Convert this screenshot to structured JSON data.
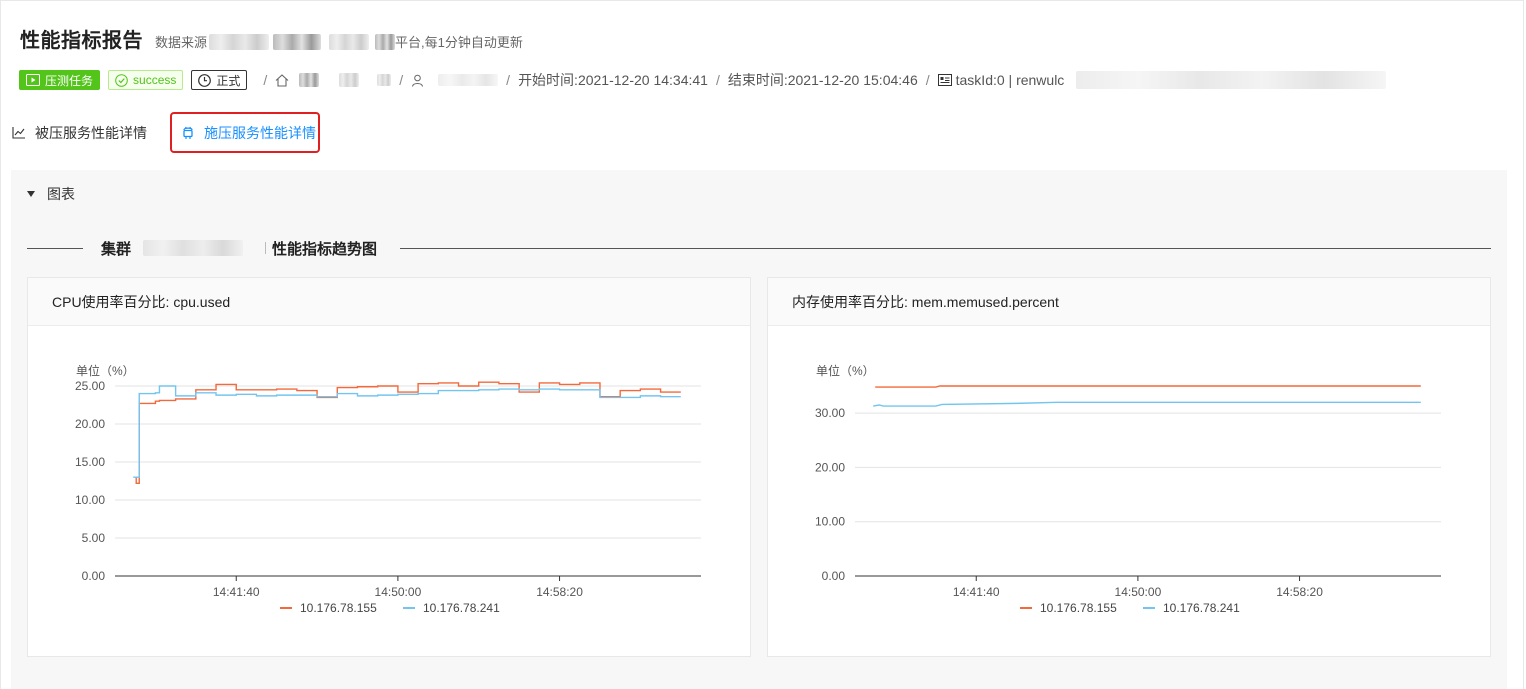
{
  "header": {
    "title": "性能指标报告",
    "subtitle_prefix": "数据来源",
    "subtitle_suffix": "平台,每1分钟自动更新"
  },
  "meta": {
    "tag_task": "压测任务",
    "tag_status": "success",
    "tag_mode": "正式",
    "start_time": "开始时间:2021-12-20 14:34:41",
    "end_time": "结束时间:2021-12-20 15:04:46",
    "task_id": "taskId:0 | renwulc"
  },
  "tabs": [
    {
      "label": "被压服务性能详情",
      "icon": "line-chart-icon",
      "active": false
    },
    {
      "label": "施压服务性能详情",
      "icon": "android-icon",
      "active": true
    }
  ],
  "section": {
    "collapse_label": "图表",
    "title_prefix": "集群",
    "title_suffix": "性能指标趋势图"
  },
  "colors": {
    "series1": "#f4693b",
    "series2": "#73c5ef",
    "link": "#1890ff"
  },
  "chart_data": [
    {
      "type": "line",
      "title": "CPU使用率百分比: cpu.used",
      "ylabel": "单位（%）",
      "ylim": [
        0,
        25
      ],
      "yticks": [
        "25.00",
        "20.00",
        "15.00",
        "10.00",
        "5.00",
        "0.00"
      ],
      "xticks": [
        "14:41:40",
        "14:50:00",
        "14:58:20"
      ],
      "xlim": [
        0,
        29
      ],
      "xtick_positions": [
        6,
        14,
        22
      ],
      "series": [
        {
          "name": "10.176.78.155",
          "step": true,
          "values": [
            [
              1,
              13
            ],
            [
              1.05,
              12.2
            ],
            [
              1.2,
              22.7
            ],
            [
              2,
              23.0
            ],
            [
              2.2,
              23.1
            ],
            [
              3,
              23.3
            ],
            [
              4,
              24.5
            ],
            [
              5,
              25.2
            ],
            [
              6,
              24.5
            ],
            [
              7,
              24.5
            ],
            [
              8,
              24.6
            ],
            [
              9,
              24.4
            ],
            [
              10,
              23.5
            ],
            [
              11,
              24.8
            ],
            [
              12,
              24.9
            ],
            [
              13,
              25.0
            ],
            [
              14,
              24.2
            ],
            [
              15,
              25.3
            ],
            [
              16,
              25.4
            ],
            [
              17,
              25.0
            ],
            [
              18,
              25.5
            ],
            [
              19,
              25.3
            ],
            [
              20,
              24.2
            ],
            [
              21,
              25.4
            ],
            [
              22,
              25.2
            ],
            [
              23,
              25.4
            ],
            [
              24,
              23.6
            ],
            [
              25,
              24.4
            ],
            [
              26,
              24.6
            ],
            [
              27,
              24.2
            ],
            [
              28,
              24.2
            ]
          ]
        },
        {
          "name": "10.176.78.241",
          "step": true,
          "values": [
            [
              0.9,
              13
            ],
            [
              1.1,
              13
            ],
            [
              1.2,
              24.0
            ],
            [
              2,
              24.1
            ],
            [
              2.2,
              25.0
            ],
            [
              3,
              23.7
            ],
            [
              4,
              24.1
            ],
            [
              5,
              23.8
            ],
            [
              6,
              23.9
            ],
            [
              7,
              23.7
            ],
            [
              8,
              23.8
            ],
            [
              9,
              23.8
            ],
            [
              10,
              23.6
            ],
            [
              11,
              24.0
            ],
            [
              12,
              23.7
            ],
            [
              13,
              23.8
            ],
            [
              14,
              23.9
            ],
            [
              15,
              24.0
            ],
            [
              16,
              24.4
            ],
            [
              17,
              24.4
            ],
            [
              18,
              24.5
            ],
            [
              19,
              24.6
            ],
            [
              20,
              24.5
            ],
            [
              21,
              24.6
            ],
            [
              22,
              24.5
            ],
            [
              23,
              24.5
            ],
            [
              24,
              23.5
            ],
            [
              25,
              23.5
            ],
            [
              26,
              23.7
            ],
            [
              27,
              23.6
            ],
            [
              28,
              23.6
            ]
          ]
        }
      ]
    },
    {
      "type": "line",
      "title": "内存使用率百分比: mem.memused.percent",
      "ylabel": "单位（%）",
      "ylim": [
        0,
        35
      ],
      "yticks": [
        "30.00",
        "20.00",
        "10.00",
        "0.00"
      ],
      "xticks": [
        "14:41:40",
        "14:50:00",
        "14:58:20"
      ],
      "xlim": [
        0,
        29
      ],
      "xtick_positions": [
        6,
        14,
        22
      ],
      "series": [
        {
          "name": "10.176.78.155",
          "step": false,
          "values": [
            [
              1,
              34.8
            ],
            [
              4,
              34.8
            ],
            [
              4.2,
              35.0
            ],
            [
              28,
              35.0
            ]
          ]
        },
        {
          "name": "10.176.78.241",
          "step": false,
          "values": [
            [
              0.9,
              31.3
            ],
            [
              1.2,
              31.5
            ],
            [
              1.4,
              31.3
            ],
            [
              4,
              31.3
            ],
            [
              4.3,
              31.6
            ],
            [
              8,
              31.8
            ],
            [
              10,
              32.0
            ],
            [
              20,
              32.0
            ],
            [
              28,
              32.0
            ]
          ]
        }
      ]
    }
  ]
}
